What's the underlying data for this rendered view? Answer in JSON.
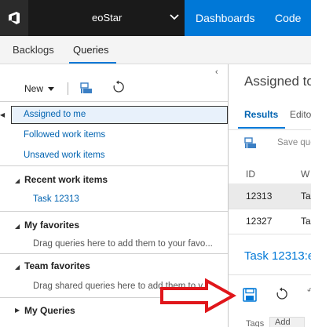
{
  "header": {
    "project_name": "eoStar",
    "nav_items": [
      "Dashboards",
      "Code"
    ]
  },
  "hub_tabs": [
    "Backlogs",
    "Queries"
  ],
  "left_toolbar": {
    "new_label": "New"
  },
  "queries": {
    "selected": "Assigned to me",
    "top_items": [
      "Followed work items",
      "Unsaved work items"
    ],
    "recent_heading": "Recent work items",
    "recent_items": [
      "Task 12313"
    ],
    "favorites_heading": "My favorites",
    "favorites_empty": "Drag queries here to add them to your favo...",
    "team_heading": "Team favorites",
    "team_empty": "Drag shared queries here to add them to y...",
    "my_queries_heading": "My Queries"
  },
  "right_pane": {
    "title": "Assigned to",
    "tabs": [
      "Results",
      "Editor"
    ],
    "save_query": "Save query",
    "columns": [
      "ID",
      "W"
    ],
    "rows": [
      {
        "id": "12313",
        "w": "Ta"
      },
      {
        "id": "12327",
        "w": "Ta"
      }
    ],
    "task_title": "Task 12313:e",
    "tags_label": "Tags",
    "add_label": "Add"
  },
  "colors": {
    "accent": "#0078d7",
    "link": "#0063b1",
    "annotation_arrow": "#e0161b",
    "topbar": "#1e1e1e"
  }
}
